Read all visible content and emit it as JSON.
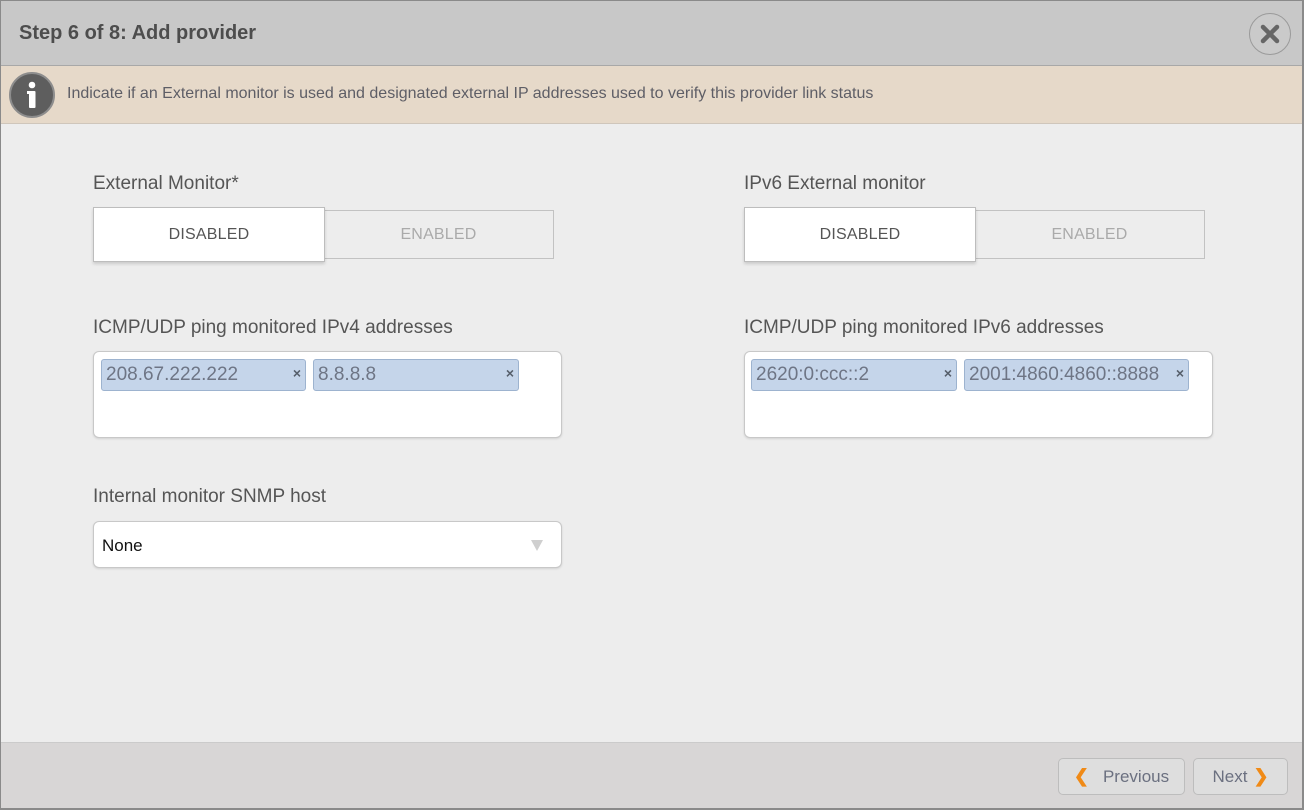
{
  "dialog": {
    "title": "Step 6 of 8: Add provider",
    "close_icon": "close-icon"
  },
  "info": {
    "icon": "info-icon",
    "text": "Indicate if an External monitor is used and designated external IP addresses used to verify this provider link status"
  },
  "external_monitor": {
    "label": "External Monitor*",
    "options": [
      "DISABLED",
      "ENABLED"
    ],
    "selected": "DISABLED"
  },
  "ipv6_external_monitor": {
    "label": "IPv6 External monitor",
    "options": [
      "DISABLED",
      "ENABLED"
    ],
    "selected": "DISABLED"
  },
  "ipv4_addresses": {
    "label": "ICMP/UDP ping monitored IPv4 addresses",
    "tags": [
      "208.67.222.222",
      "8.8.8.8"
    ],
    "remove_glyph": "×"
  },
  "ipv6_addresses": {
    "label": "ICMP/UDP ping monitored IPv6 addresses",
    "tags": [
      "2620:0:ccc::2",
      "2001:4860:4860::8888"
    ],
    "remove_glyph": "×"
  },
  "snmp_host": {
    "label": "Internal monitor SNMP host",
    "value": "None"
  },
  "footer": {
    "previous_label": "Previous",
    "next_label": "Next",
    "previous_chevron": "❮",
    "next_chevron": "❯",
    "accent_color": "#f08a16"
  }
}
